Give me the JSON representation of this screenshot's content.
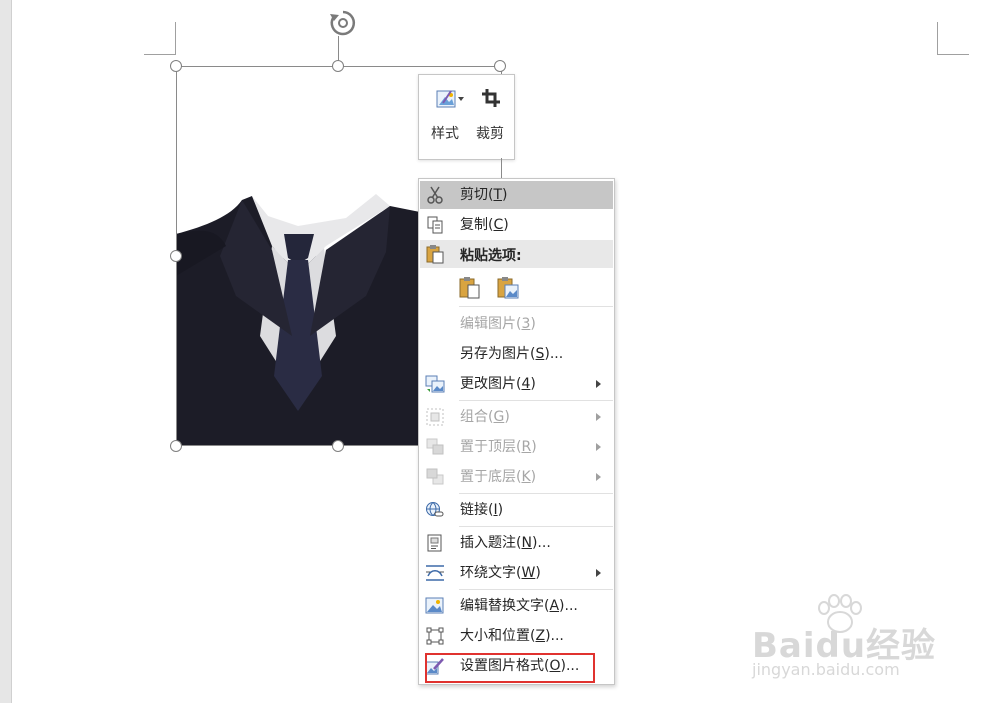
{
  "mini_toolbar": {
    "style_label": "样式",
    "crop_label": "裁剪"
  },
  "context_menu": {
    "items": [
      {
        "label": "剪切(",
        "key": "T",
        "tail": ")"
      },
      {
        "label": "复制(",
        "key": "C",
        "tail": ")"
      },
      {
        "label": "粘贴选项:"
      },
      {
        "label": "编辑图片(",
        "key": "3",
        "tail": ")"
      },
      {
        "label": "另存为图片(",
        "key": "S",
        "tail": ")..."
      },
      {
        "label": "更改图片(",
        "key": "4",
        "tail": ")"
      },
      {
        "label": "组合(",
        "key": "G",
        "tail": ")"
      },
      {
        "label": "置于顶层(",
        "key": "R",
        "tail": ")"
      },
      {
        "label": "置于底层(",
        "key": "K",
        "tail": ")"
      },
      {
        "label": "链接(",
        "key": "I",
        "tail": ")"
      },
      {
        "label": "插入题注(",
        "key": "N",
        "tail": ")..."
      },
      {
        "label": "环绕文字(",
        "key": "W",
        "tail": ")"
      },
      {
        "label": "编辑替换文字(",
        "key": "A",
        "tail": ")..."
      },
      {
        "label": "大小和位置(",
        "key": "Z",
        "tail": ")..."
      },
      {
        "label": "设置图片格式(",
        "key": "O",
        "tail": ")..."
      }
    ]
  },
  "watermark": {
    "brand": "Baidu经验",
    "url": "jingyan.baidu.com"
  },
  "colors": {
    "highlight": "#e0322f",
    "hover": "#c6c6c6",
    "disabled_text": "#a6a6a6"
  }
}
